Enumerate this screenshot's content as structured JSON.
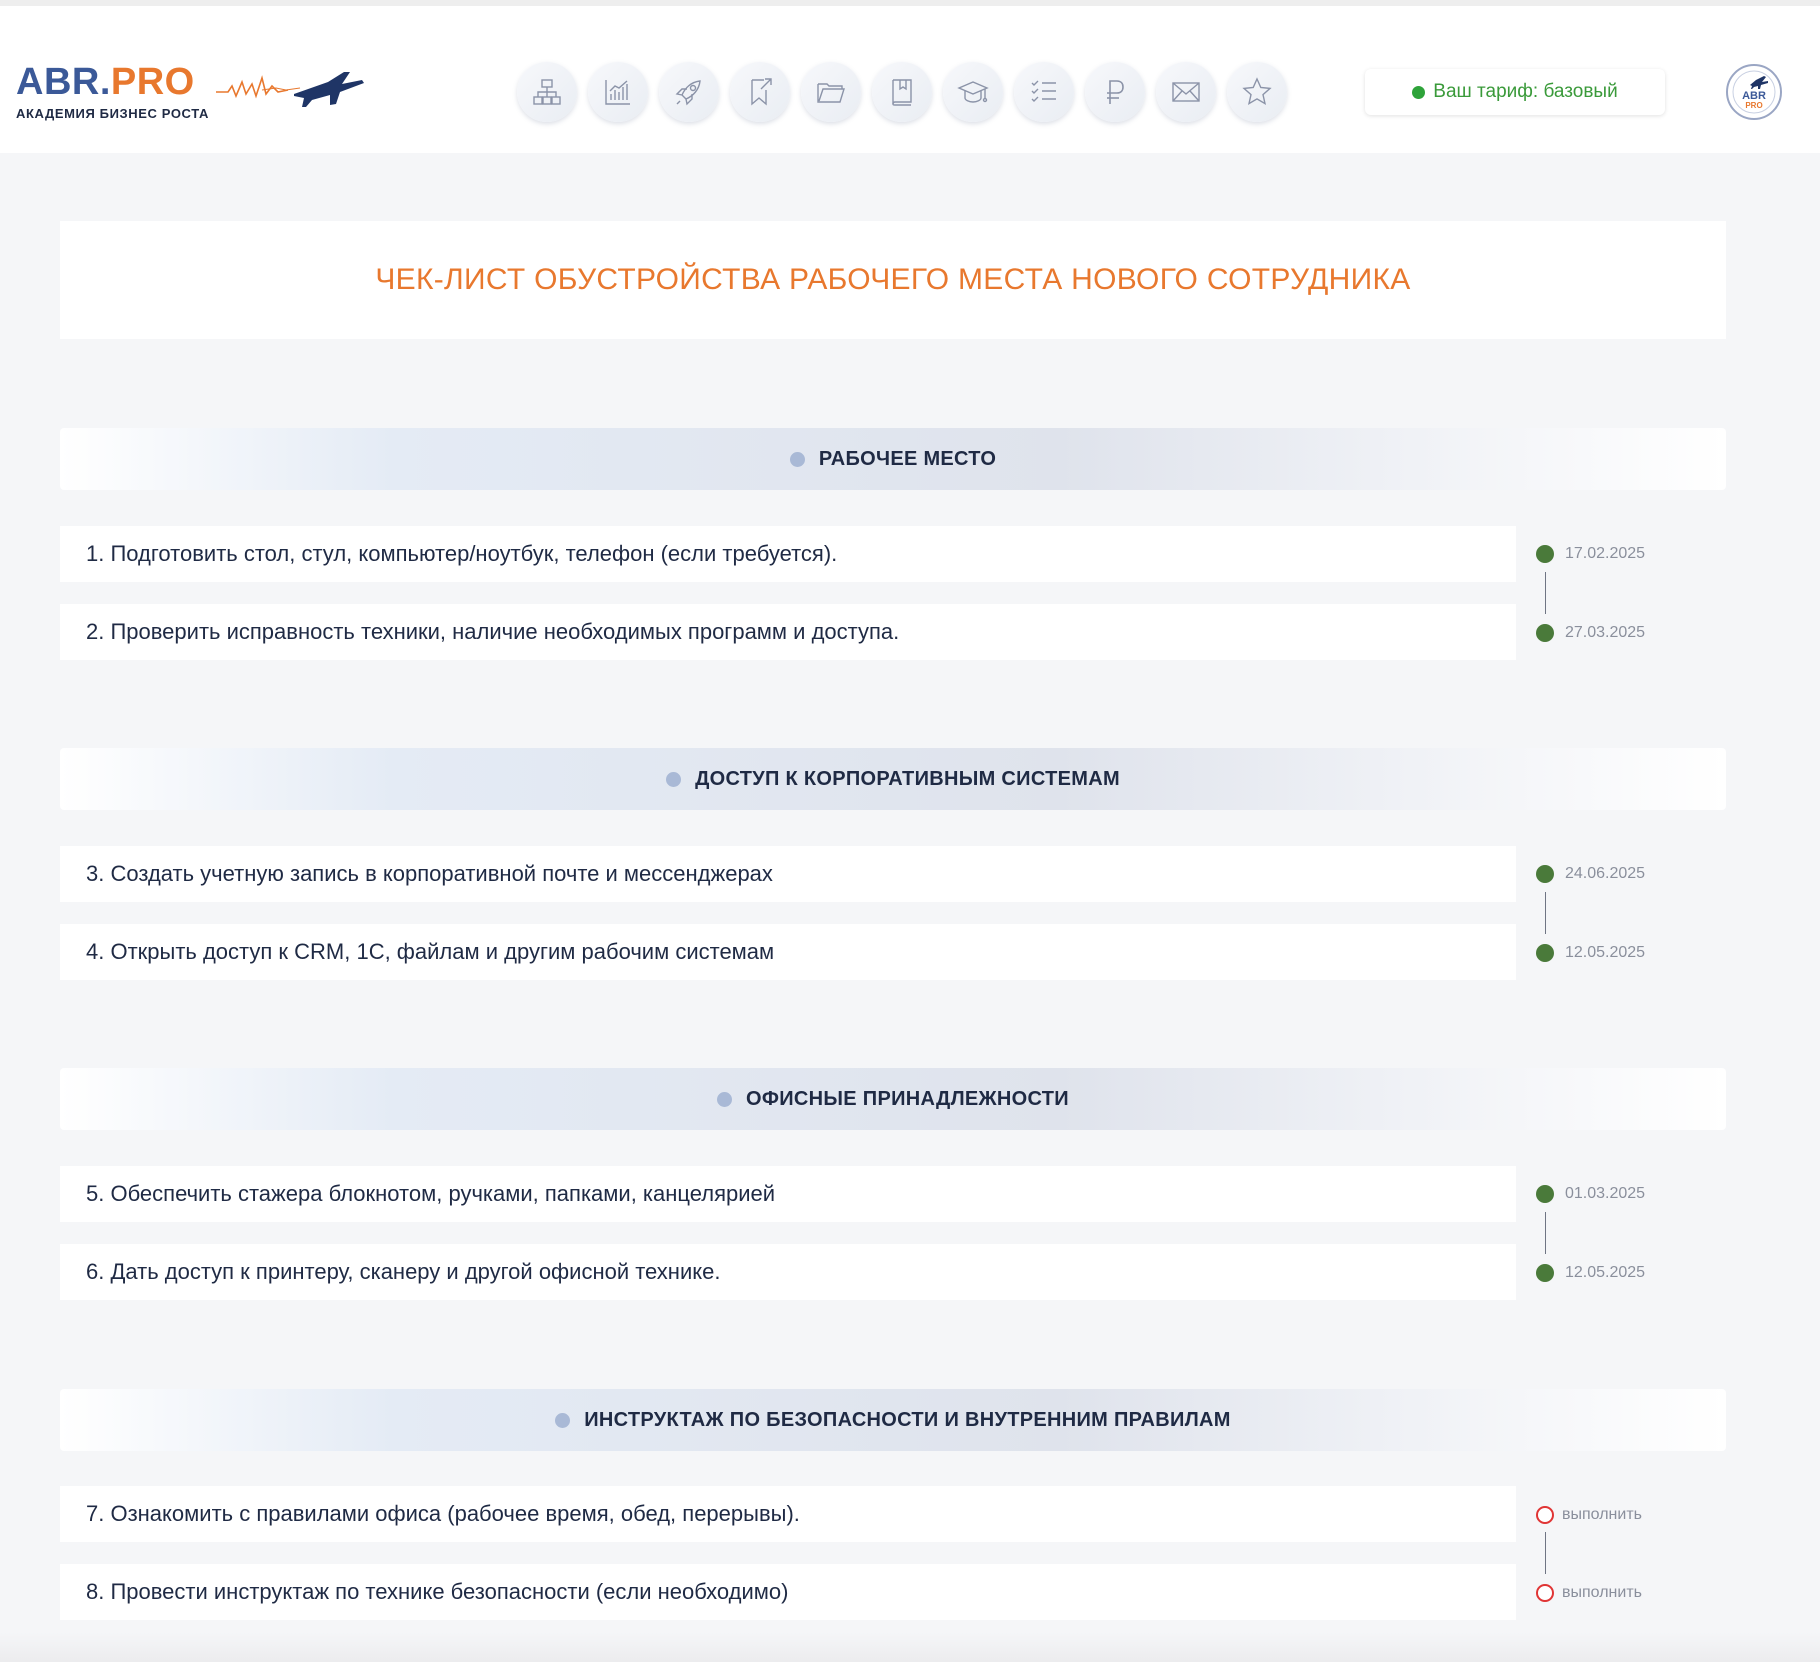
{
  "header": {
    "logo": {
      "brand_abr": "ABR",
      "brand_dot": ".",
      "brand_pro": "PRO",
      "subtitle": "АКАДЕМИЯ БИЗНЕС РОСТА"
    },
    "nav_icons": [
      "org-structure-icon",
      "analytics-chart-icon",
      "rocket-icon",
      "bookmark-arrow-icon",
      "folder-icon",
      "book-icon",
      "graduation-cap-icon",
      "checklist-icon",
      "ruble-icon",
      "mail-icon",
      "star-icon"
    ],
    "tariff_label": "Ваш тариф: базовый",
    "avatar": {
      "abr": "ABR",
      "pro": "PRO"
    }
  },
  "page_title": "ЧЕК-ЛИСТ ОБУСТРОЙСТВА РАБОЧЕГО МЕСТА НОВОГО СОТРУДНИКА",
  "sections": [
    {
      "title": "РАБОЧЕЕ МЕСТО",
      "items": [
        {
          "text": "1. Подготовить стол, стул, компьютер/ноутбук, телефон (если требуется).",
          "status": "done",
          "date": "17.02.2025"
        },
        {
          "text": "2. Проверить исправность техники, наличие необходимых программ и доступа.",
          "status": "done",
          "date": "27.03.2025"
        }
      ]
    },
    {
      "title": "ДОСТУП К КОРПОРАТИВНЫМ СИСТЕМАМ",
      "items": [
        {
          "text": "3. Создать учетную запись в корпоративной почте и мессенджерах",
          "status": "done",
          "date": "24.06.2025"
        },
        {
          "text": "4. Открыть доступ к CRM, 1С, файлам и другим рабочим системам",
          "status": "done",
          "date": "12.05.2025"
        }
      ]
    },
    {
      "title": "ОФИСНЫЕ ПРИНАДЛЕЖНОСТИ",
      "items": [
        {
          "text": "5. Обеспечить стажера блокнотом, ручками, папками, канцелярией",
          "status": "done",
          "date": "01.03.2025"
        },
        {
          "text": "6. Дать доступ к принтеру, сканеру и другой офисной технике.",
          "status": "done",
          "date": "12.05.2025"
        }
      ]
    },
    {
      "title": "ИНСТРУКТАЖ ПО БЕЗОПАСНОСТИ И ВНУТРЕННИМ ПРАВИЛАМ",
      "items": [
        {
          "text": "7. Ознакомить с правилами офиса (рабочее время, обед, перерывы).",
          "status": "todo",
          "date": "выполнить"
        },
        {
          "text": "8. Провести инструктаж по технике безопасности (если необходимо)",
          "status": "todo",
          "date": "выполнить"
        }
      ]
    }
  ],
  "colors": {
    "accent_orange": "#e8782e",
    "brand_blue": "#3b5998",
    "done_green": "#4a7a3a",
    "todo_red": "#e03535",
    "tariff_green": "#3a9a3a"
  }
}
